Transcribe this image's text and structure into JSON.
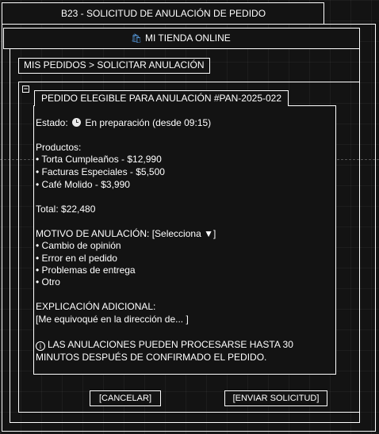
{
  "window": {
    "title": "B23 - SOLICITUD DE ANULACIÓN DE PEDIDO"
  },
  "store": {
    "icon": "shopping-bag-icon",
    "name": "MI TIENDA ONLINE"
  },
  "breadcrumb": "MIS PEDIDOS > SOLICITAR ANULACIÓN",
  "group": {
    "toggle": "−"
  },
  "panel": {
    "title": "PEDIDO ELEGIBLE PARA ANULACIÓN #PAN-2025-022",
    "status_label": "Estado:",
    "status_icon": "clock-icon",
    "status_value": "En preparación (desde 09:15)",
    "products_label": "Productos:",
    "products": [
      "• Torta Cumpleaños - $12,990",
      "• Facturas Especiales - $5,500",
      "• Café Molido - $3,990"
    ],
    "total": "Total: $22,480",
    "reason_label": "MOTIVO DE ANULACIÓN:",
    "reason_select": "[Selecciona ▼]",
    "reasons": [
      "• Cambio de opinión",
      "• Error en el pedido",
      "• Problemas de entrega",
      "• Otro"
    ],
    "explanation_label": "EXPLICACIÓN ADICIONAL:",
    "explanation_value": "[Me equivoqué en la dirección de... ]",
    "notice_icon": "info-icon",
    "notice_line1": "LAS ANULACIONES PUEDEN PROCESARSE HASTA 30",
    "notice_line2": "MINUTOS DESPUÉS DE CONFIRMADO EL PEDIDO."
  },
  "buttons": {
    "cancel": "[CANCELAR]",
    "submit": "[ENVIAR SOLICITUD]"
  }
}
